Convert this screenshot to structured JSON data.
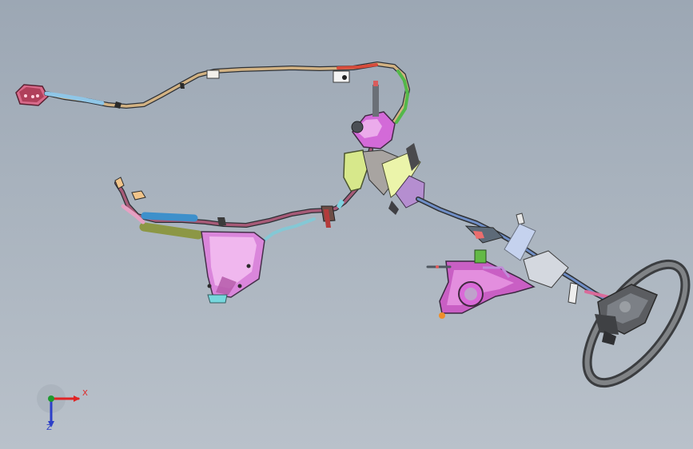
{
  "viewport": {
    "background_top": "#9ca7b4",
    "background_bottom": "#b9c1ca"
  },
  "triad": {
    "x_label": "X",
    "z_label": "Z",
    "x_color": "#e02424",
    "y_color": "#1f9a2f",
    "z_color": "#2c3fc8"
  },
  "model": {
    "parts": [
      "connector-left",
      "upper-harness",
      "lower-harness",
      "reservoir-bracket",
      "master-cylinder",
      "steering-shaft",
      "pedal-bracket",
      "steering-wheel"
    ]
  }
}
